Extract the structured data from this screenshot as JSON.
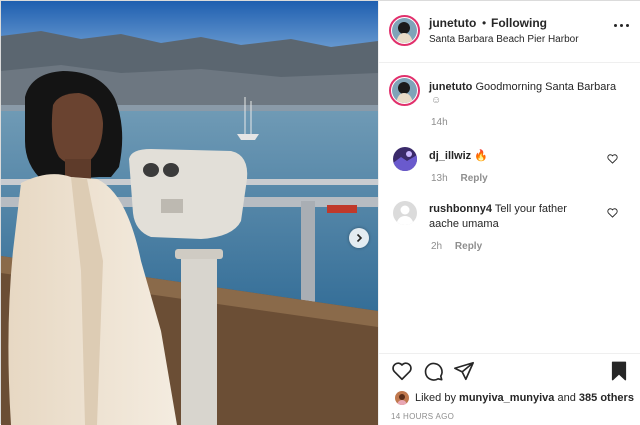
{
  "header": {
    "username": "junetuto",
    "separator": "•",
    "follow_status": "Following",
    "location": "Santa Barbara Beach Pier Harbor"
  },
  "caption": {
    "username": "junetuto",
    "text": "Goodmorning Santa Barbara",
    "emoji": "☺",
    "time": "14h"
  },
  "comments": [
    {
      "username": "dj_illwiz",
      "text": "🔥",
      "time": "13h",
      "reply_label": "Reply"
    },
    {
      "username": "rushbonny4",
      "text": "Tell your father aache umama",
      "time": "2h",
      "reply_label": "Reply"
    }
  ],
  "likes": {
    "prefix": "Liked by",
    "user": "munyiva_munyiva",
    "joiner": "and",
    "others": "385 others"
  },
  "post_age": "14 HOURS AGO",
  "icons": {
    "more": "more-options-icon",
    "next": "chevron-right-icon",
    "like": "heart-icon",
    "comment": "comment-icon",
    "share": "share-icon",
    "save": "bookmark-icon"
  },
  "colors": {
    "story_ring": "#e1306c",
    "muted_text": "#8e8e8e",
    "text": "#262626"
  }
}
